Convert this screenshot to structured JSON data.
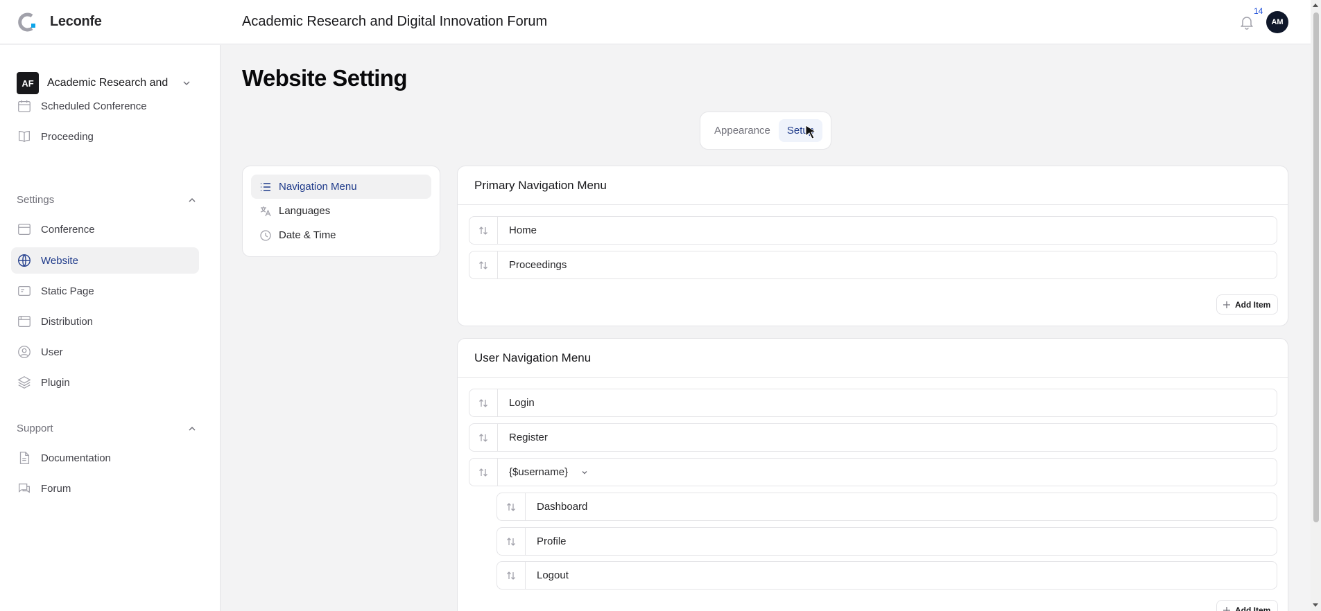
{
  "header": {
    "brand": "Leconfe",
    "conference_title": "Academic Research and Digital Innovation Forum",
    "notification_count": "14",
    "avatar_initials": "AM"
  },
  "sidebar": {
    "conference_switcher": {
      "initials": "AF",
      "name": "Academic Research and Digital Innovation Forum"
    },
    "top_items": [
      {
        "label": "Scheduled Conference",
        "icon": "calendar-icon"
      },
      {
        "label": "Proceeding",
        "icon": "book-icon"
      }
    ],
    "settings_group": {
      "label": "Settings",
      "items": [
        {
          "label": "Conference",
          "icon": "window-icon"
        },
        {
          "label": "Website",
          "icon": "globe-icon",
          "active": true
        },
        {
          "label": "Static Page",
          "icon": "page-icon"
        },
        {
          "label": "Distribution",
          "icon": "browser-icon"
        },
        {
          "label": "User",
          "icon": "user-circle-icon"
        },
        {
          "label": "Plugin",
          "icon": "layers-icon"
        }
      ]
    },
    "support_group": {
      "label": "Support",
      "items": [
        {
          "label": "Documentation",
          "icon": "document-icon"
        },
        {
          "label": "Forum",
          "icon": "chat-icon"
        }
      ]
    }
  },
  "main": {
    "title": "Website Setting",
    "tabs": [
      {
        "label": "Appearance",
        "active": false
      },
      {
        "label": "Setup",
        "active": true
      }
    ],
    "subnav": [
      {
        "label": "Navigation Menu",
        "icon": "list-icon",
        "active": true
      },
      {
        "label": "Languages",
        "icon": "translate-icon"
      },
      {
        "label": "Date & Time",
        "icon": "clock-icon"
      }
    ],
    "primary_menu": {
      "title": "Primary Navigation Menu",
      "items": [
        "Home",
        "Proceedings"
      ],
      "add_label": "Add Item"
    },
    "user_menu": {
      "title": "User Navigation Menu",
      "items": [
        "Login",
        "Register",
        "{$username}"
      ],
      "children": [
        "Dashboard",
        "Profile",
        "Logout"
      ],
      "add_label": "Add Item"
    }
  },
  "colors": {
    "accent": "#1e3a8a",
    "active_bg": "#f1f1f2",
    "border": "#e4e4e7"
  }
}
